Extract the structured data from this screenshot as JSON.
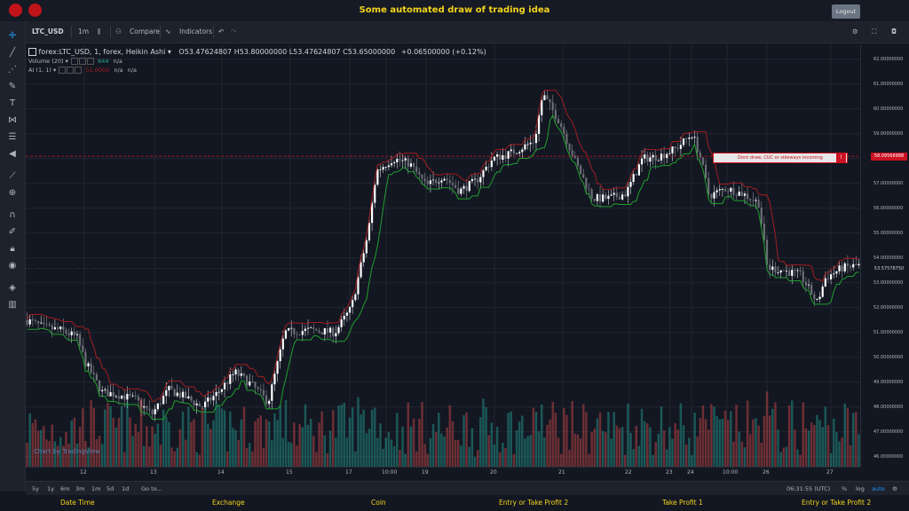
{
  "header": {
    "title": "Some automated draw of trading idea",
    "logout_label": "Logout"
  },
  "toolbar": {
    "symbol": "LTC_USD",
    "interval": "1m",
    "compare_label": "Compare",
    "indicators_label": "Indicators"
  },
  "legend": {
    "title": "forex:LTC_USD, 1, forex, Heikin Ashi",
    "open": "O53.47624807",
    "high": "H53.80000000",
    "low": "L53.47624807",
    "close": "C53.65000000",
    "change": "+0.06500000 (+0.12%)",
    "volume_label": "Volume (20)",
    "volume_value": "644",
    "volume_extra": "n/a",
    "ai_label": "AI (1, 1)",
    "ai_value1": "51.0000",
    "ai_value2": "n/a",
    "ai_value3": "n/a"
  },
  "watermark": "Chart by TradingView",
  "alert": {
    "text": "Dont draw, CUC or sideways incoming",
    "button": "!"
  },
  "price_axis": {
    "ticks": [
      "62.00000000",
      "61.00000000",
      "60.00000000",
      "59.00000000",
      "58.00000000",
      "57.00000000",
      "56.00000000",
      "55.00000000",
      "54.00000000",
      "53.00000000",
      "52.00000000",
      "51.00000000",
      "50.00000000",
      "49.00000000",
      "48.00000000",
      "47.00000000",
      "46.00000000"
    ],
    "alert_price": "58.09566988",
    "last_price": "53.57578750"
  },
  "time_axis": {
    "ticks": [
      "12",
      "13",
      "14",
      "15",
      "17",
      "10:00",
      "19",
      "20",
      "21",
      "22",
      "23",
      "24",
      "10:00",
      "26",
      "27"
    ]
  },
  "bottombar": {
    "ranges": [
      "5y",
      "1y",
      "6m",
      "3m",
      "1m",
      "5d",
      "1d"
    ],
    "goto": "Go to...",
    "clock": "06:31:55 (UTC)",
    "pct": "%",
    "log": "log",
    "auto": "auto"
  },
  "footer": {
    "labels": [
      "Date Time",
      "Exchange",
      "Coin",
      "Entry or Take Profit 2",
      "Take Profit 1",
      "Entry or Take Profit 2"
    ]
  },
  "colors": {
    "up": "#26a69a",
    "down": "#ef5350",
    "green_line": "#1fa02c",
    "red_line": "#a01e1e",
    "accent": "#f5d51b"
  },
  "chart_data": {
    "type": "candlestick",
    "ylim": [
      45.6,
      62.6
    ],
    "price_path": [
      [
        0,
        51.5
      ],
      [
        0.02,
        51.2
      ],
      [
        0.04,
        51.1
      ],
      [
        0.06,
        50.8
      ],
      [
        0.07,
        49.8
      ],
      [
        0.09,
        48.6
      ],
      [
        0.11,
        48.5
      ],
      [
        0.13,
        48.3
      ],
      [
        0.15,
        47.7
      ],
      [
        0.17,
        48.7
      ],
      [
        0.19,
        48.4
      ],
      [
        0.21,
        48.0
      ],
      [
        0.23,
        48.6
      ],
      [
        0.25,
        49.4
      ],
      [
        0.27,
        48.9
      ],
      [
        0.29,
        48.2
      ],
      [
        0.31,
        51.0
      ],
      [
        0.34,
        51.1
      ],
      [
        0.37,
        51.0
      ],
      [
        0.39,
        52.0
      ],
      [
        0.41,
        55.0
      ],
      [
        0.42,
        57.5
      ],
      [
        0.44,
        58.0
      ],
      [
        0.46,
        57.8
      ],
      [
        0.48,
        56.9
      ],
      [
        0.5,
        57.3
      ],
      [
        0.52,
        56.7
      ],
      [
        0.54,
        57.1
      ],
      [
        0.56,
        58.0
      ],
      [
        0.58,
        58.2
      ],
      [
        0.61,
        58.7
      ],
      [
        0.62,
        60.6
      ],
      [
        0.64,
        59.5
      ],
      [
        0.66,
        57.8
      ],
      [
        0.68,
        56.4
      ],
      [
        0.7,
        56.4
      ],
      [
        0.72,
        56.6
      ],
      [
        0.74,
        58.0
      ],
      [
        0.76,
        58.1
      ],
      [
        0.78,
        58.4
      ],
      [
        0.8,
        59.0
      ],
      [
        0.81,
        58.0
      ],
      [
        0.82,
        56.5
      ],
      [
        0.84,
        56.8
      ],
      [
        0.86,
        56.6
      ],
      [
        0.88,
        56.2
      ],
      [
        0.89,
        53.6
      ],
      [
        0.91,
        53.5
      ],
      [
        0.93,
        53.3
      ],
      [
        0.95,
        52.2
      ],
      [
        0.96,
        53.2
      ],
      [
        0.98,
        53.6
      ],
      [
        1.0,
        53.7
      ]
    ]
  }
}
